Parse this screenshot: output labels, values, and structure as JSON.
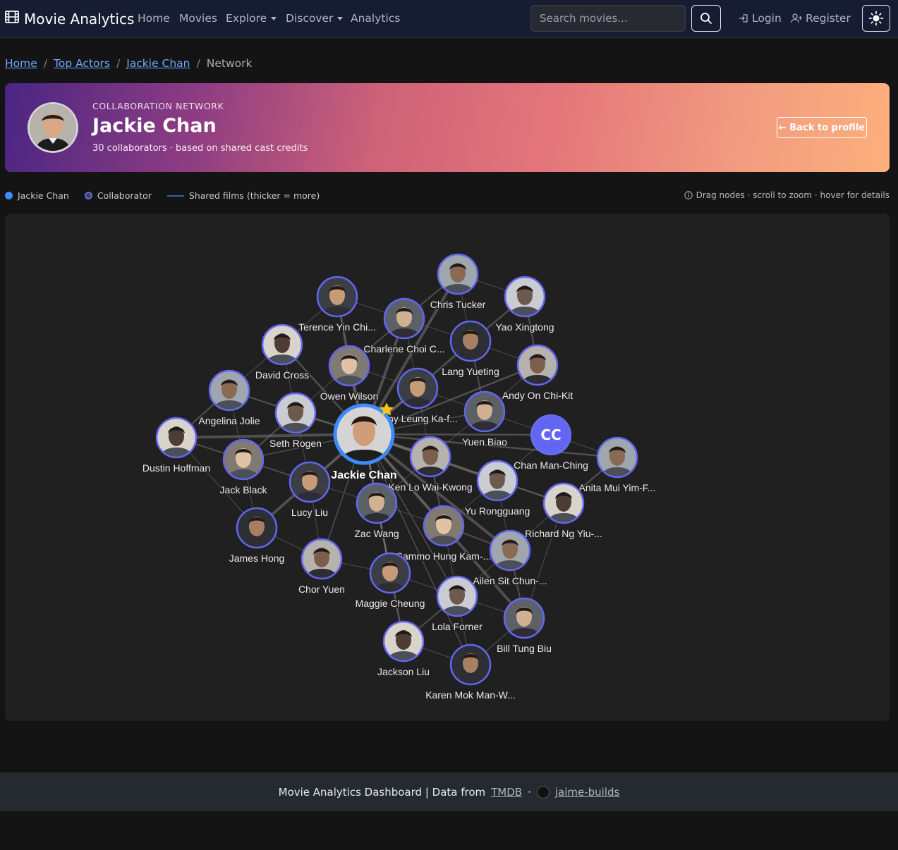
{
  "navbar": {
    "brand": "Movie Analytics",
    "links": [
      {
        "label": "Home"
      },
      {
        "label": "Movies"
      },
      {
        "label": "Explore"
      },
      {
        "label": "Discover"
      },
      {
        "label": "Analytics"
      }
    ],
    "search_placeholder": "Search movies...",
    "login": "Login",
    "register": "Register",
    "icons": {
      "brand": "film-icon",
      "search": "search-icon",
      "login": "login-icon",
      "register": "person-plus-icon",
      "theme": "sun-icon"
    }
  },
  "breadcrumb": {
    "items": [
      "Home",
      "Top Actors",
      "Jackie Chan"
    ],
    "current": "Network"
  },
  "hero": {
    "kicker": "COLLABORATION NETWORK",
    "name": "Jackie Chan",
    "subtitle": "30 collaborators · based on shared cast credits",
    "back_button": "← Back to profile"
  },
  "legend": {
    "center": "Jackie Chan",
    "collaborator": "Collaborator",
    "edges": "Shared films (thicker = more)",
    "hint": "Drag nodes · scroll to zoom · hover for details",
    "colors": {
      "center": "#3d8bfd",
      "collaborator": "#6366f1",
      "edge": "#3b5c9e"
    }
  },
  "network": {
    "center": {
      "label": "Jackie Chan"
    },
    "nodes": [
      {
        "label": "Chris Tucker"
      },
      {
        "label": "Terence Yin Chi..."
      },
      {
        "label": "Yao Xingtong"
      },
      {
        "label": "Charlene Choi C..."
      },
      {
        "label": "David Cross"
      },
      {
        "label": "Lang Yueting"
      },
      {
        "label": "Owen Wilson"
      },
      {
        "label": "Andy On Chi-Kit"
      },
      {
        "label": "Angelina Jolie"
      },
      {
        "label": "Tony Leung Ka-f..."
      },
      {
        "label": "Seth Rogen"
      },
      {
        "label": "Yuen Biao"
      },
      {
        "label": "Dustin Hoffman"
      },
      {
        "label": "Chan Man-Ching",
        "initials": "CC"
      },
      {
        "label": "Jack Black"
      },
      {
        "label": "Ken Lo Wai-Kwong"
      },
      {
        "label": "Anita Mui Yim-F..."
      },
      {
        "label": "Lucy Liu"
      },
      {
        "label": "Yu Rongguang"
      },
      {
        "label": "Zac Wang"
      },
      {
        "label": "Richard Ng Yiu-..."
      },
      {
        "label": "James Hong"
      },
      {
        "label": "Sammo Hung Kam-..."
      },
      {
        "label": "Chor Yuen"
      },
      {
        "label": "Ailen Sit Chun-..."
      },
      {
        "label": "Maggie Cheung"
      },
      {
        "label": "Lola Forner"
      },
      {
        "label": "Bill Tung Biu"
      },
      {
        "label": "Jackson Liu"
      },
      {
        "label": "Karen Mok Man-W..."
      }
    ]
  },
  "footer": {
    "text": "Movie Analytics Dashboard | Data from",
    "tmdb": "TMDB",
    "separator": "·",
    "author": "jaime-builds"
  }
}
